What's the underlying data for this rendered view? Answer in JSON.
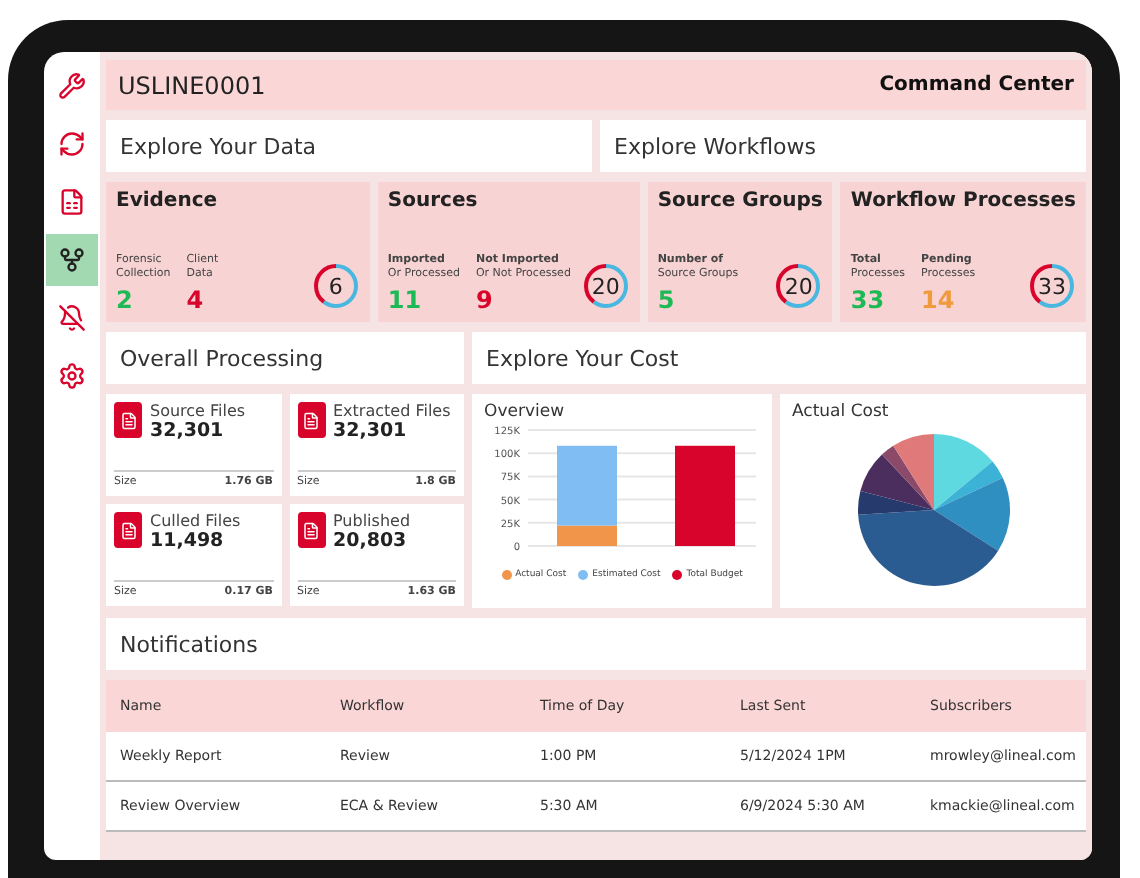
{
  "sidebar": {
    "items": [
      {
        "selected": false
      },
      {
        "selected": false
      },
      {
        "selected": false
      },
      {
        "selected": true
      },
      {
        "selected": false
      },
      {
        "selected": false
      }
    ]
  },
  "header": {
    "id": "USLINE0001",
    "title": "Command Center"
  },
  "explore": [
    "Explore Your Data",
    "Explore Workflows"
  ],
  "stats": [
    {
      "title": "Evidence",
      "metrics": [
        {
          "label": "Forensic",
          "sublabel": "Collection",
          "value": "2",
          "color": "#1db954"
        },
        {
          "label": "Client",
          "sublabel": "Data",
          "value": "4",
          "color": "#d9042b"
        }
      ],
      "total": "6"
    },
    {
      "title": "Sources",
      "metrics": [
        {
          "label": "Imported",
          "sublabel": "Or Processed",
          "value": "11",
          "color": "#1db954"
        },
        {
          "label": "Not Imported",
          "sublabel": "Or Not Processed",
          "value": "9",
          "color": "#d9042b"
        }
      ],
      "total": "20"
    },
    {
      "title": "Source Groups",
      "metrics": [
        {
          "label": "Number of",
          "sublabel": "Source Groups",
          "value": "5",
          "color": "#1db954"
        }
      ],
      "total": "20"
    },
    {
      "title": "Workflow Processes",
      "metrics": [
        {
          "label": "Total",
          "sublabel": "Processes",
          "value": "33",
          "color": "#1db954"
        },
        {
          "label": "Pending",
          "sublabel": "Processes",
          "value": "14",
          "color": "#f09a3e"
        }
      ],
      "total": "33"
    }
  ],
  "processing": {
    "title": "Overall Processing",
    "files": [
      {
        "name": "Source Files",
        "count": "32,301",
        "size_label": "Size",
        "size": "1.76 GB"
      },
      {
        "name": "Extracted Files",
        "count": "32,301",
        "size_label": "Size",
        "size": "1.8 GB"
      },
      {
        "name": "Culled Files",
        "count": "11,498",
        "size_label": "Size",
        "size": "0.17 GB"
      },
      {
        "name": "Published",
        "count": "20,803",
        "size_label": "Size",
        "size": "1.63 GB"
      }
    ]
  },
  "cost": {
    "title": "Explore Your Cost",
    "overview": {
      "title": "Overview",
      "chart_data": {
        "type": "bar",
        "stacked": true,
        "grid": true,
        "legend": "bottom",
        "categories": [
          null,
          null
        ],
        "ylim": [
          0,
          125000
        ],
        "yticks": [
          {
            "value": 0,
            "label": "0"
          },
          {
            "value": 25000,
            "label": "25K"
          },
          {
            "value": 50000,
            "label": "50K"
          },
          {
            "value": 75000,
            "label": "75K"
          },
          {
            "value": 100000,
            "label": "100K"
          },
          {
            "value": 125000,
            "label": "125K"
          }
        ],
        "series": [
          {
            "name": "Actual Cost",
            "color": "#f0954a",
            "values": [
              22000,
              null
            ]
          },
          {
            "name": "Estimated Cost",
            "color": "#80bdf2",
            "values": [
              86000,
              null
            ]
          },
          {
            "name": "Total Budget",
            "color": "#d9042b",
            "values": [
              null,
              108000
            ]
          }
        ]
      }
    },
    "actual": {
      "title": "Actual Cost"
    }
  },
  "notifications": {
    "title": "Notifications",
    "columns": [
      "Name",
      "Workflow",
      "Time of Day",
      "Last Sent",
      "Subscribers"
    ],
    "rows": [
      [
        "Weekly Report",
        "Review",
        "1:00 PM",
        "5/12/2024 1PM",
        "mrowley@lineal.com"
      ],
      [
        "Review Overview",
        "ECA & Review",
        "5:30 AM",
        "6/9/2024 5:30 AM",
        "kmackie@lineal.com"
      ]
    ]
  }
}
